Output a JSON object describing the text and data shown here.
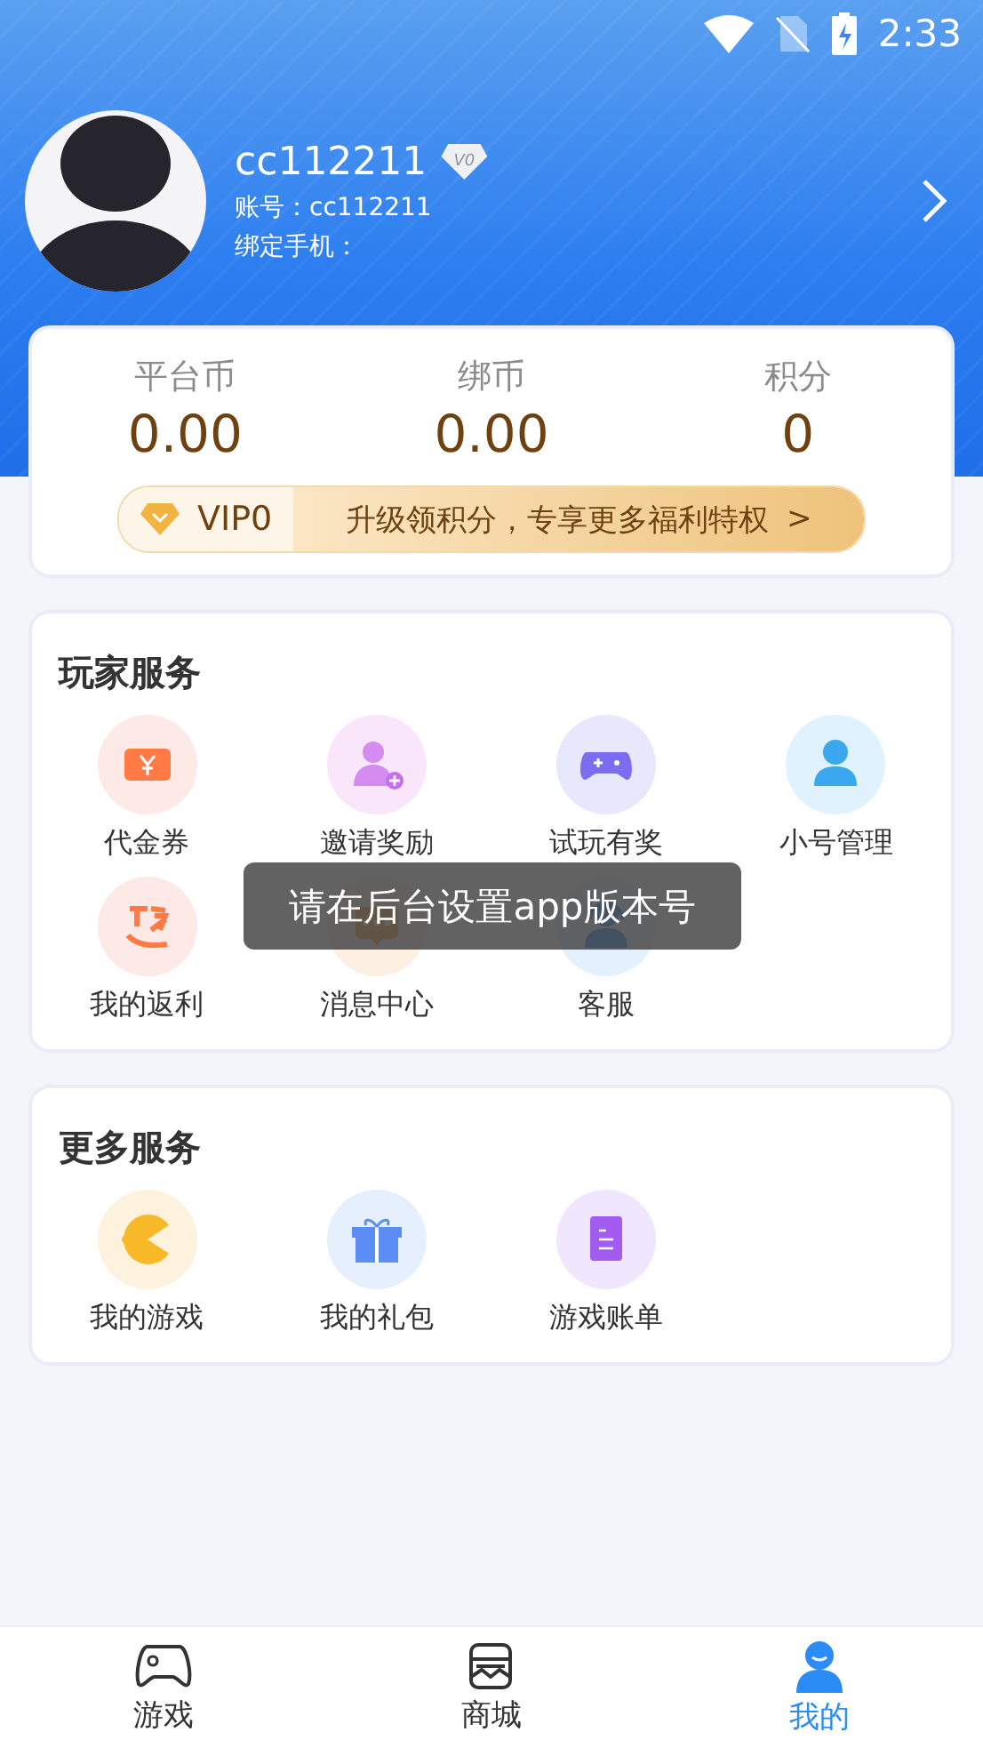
{
  "status_bar": {
    "time": "2:33"
  },
  "profile": {
    "name": "cc112211",
    "vip_badge": "V0",
    "account": "账号：cc112211",
    "phone": "绑定手机："
  },
  "balances": [
    {
      "label": "平台币",
      "value": "0.00"
    },
    {
      "label": "绑币",
      "value": "0.00"
    },
    {
      "label": "积分",
      "value": "0"
    }
  ],
  "vip_banner": {
    "level": "VIP0",
    "text": "升级领积分，专享更多福利特权",
    "arrow": ">"
  },
  "sections": [
    {
      "title": "玩家服务",
      "items": [
        {
          "label": "代金券"
        },
        {
          "label": "邀请奖励"
        },
        {
          "label": "试玩有奖"
        },
        {
          "label": "小号管理"
        },
        {
          "label": "我的返利"
        },
        {
          "label": "消息中心"
        },
        {
          "label": "客服"
        }
      ]
    },
    {
      "title": "更多服务",
      "items": [
        {
          "label": "我的游戏"
        },
        {
          "label": "我的礼包"
        },
        {
          "label": "游戏账单"
        }
      ]
    }
  ],
  "toast": "请在后台设置app版本号",
  "tab_bar": [
    {
      "label": "游戏",
      "selected": false
    },
    {
      "label": "商城",
      "selected": false
    },
    {
      "label": "我的",
      "selected": true
    }
  ]
}
